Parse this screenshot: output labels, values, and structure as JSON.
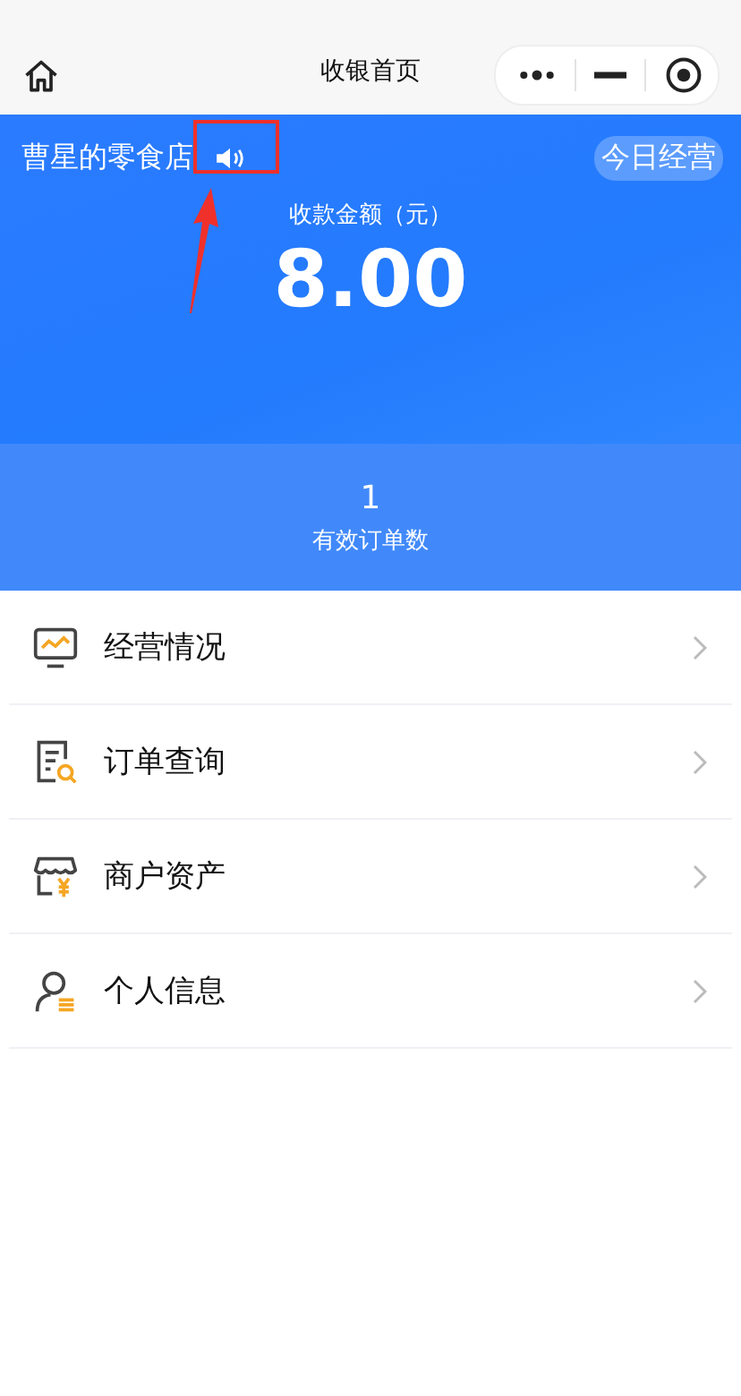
{
  "nav": {
    "title": "收银首页"
  },
  "header": {
    "shop_name": "曹星的零食店",
    "today_button": "今日经营",
    "amount_label": "收款金额（元）",
    "amount": "8.00"
  },
  "stats": {
    "value": "1",
    "label": "有效订单数"
  },
  "menu": [
    {
      "label": "经营情况",
      "kind": "chart"
    },
    {
      "label": "订单查询",
      "kind": "order"
    },
    {
      "label": "商户资产",
      "kind": "shop"
    },
    {
      "label": "个人信息",
      "kind": "user"
    }
  ]
}
